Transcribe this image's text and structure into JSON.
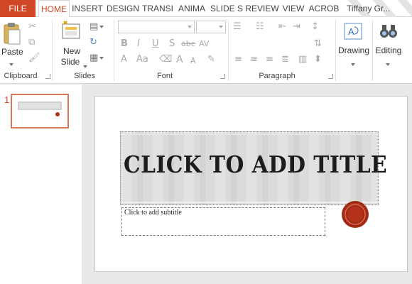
{
  "tabs": [
    {
      "key": "file",
      "label": "FILE"
    },
    {
      "key": "home",
      "label": "HOME"
    },
    {
      "key": "insert",
      "label": "INSERT"
    },
    {
      "key": "design",
      "label": "DESIGN"
    },
    {
      "key": "transitions",
      "label": "TRANSI"
    },
    {
      "key": "animations",
      "label": "ANIMA"
    },
    {
      "key": "slideshow",
      "label": "SLIDE S"
    },
    {
      "key": "review",
      "label": "REVIEW"
    },
    {
      "key": "view",
      "label": "VIEW"
    },
    {
      "key": "acrobat",
      "label": "ACROB"
    }
  ],
  "user_name": "Tiffany Gr...",
  "colors": {
    "accent": "#d24726",
    "seal": "#b5321a"
  },
  "ribbon": {
    "clipboard": {
      "label": "Clipboard",
      "paste": "Paste"
    },
    "slides": {
      "label": "Slides",
      "new_slide_line1": "New",
      "new_slide_line2": "Slide"
    },
    "font": {
      "label": "Font",
      "bold": "B",
      "italic": "I",
      "underline": "U",
      "shadow": "S",
      "strike": "abc",
      "spacing": "AV",
      "case": "Aa",
      "color": "A",
      "grow": "A",
      "shrink": "A"
    },
    "paragraph": {
      "label": "Paragraph"
    },
    "drawing": {
      "label": "Drawing"
    },
    "editing": {
      "label": "Editing"
    }
  },
  "thumbnails": [
    {
      "number": "1"
    }
  ],
  "slide": {
    "title_placeholder": "CLICK TO ADD TITLE",
    "subtitle_placeholder": "Click to add subtitle"
  }
}
